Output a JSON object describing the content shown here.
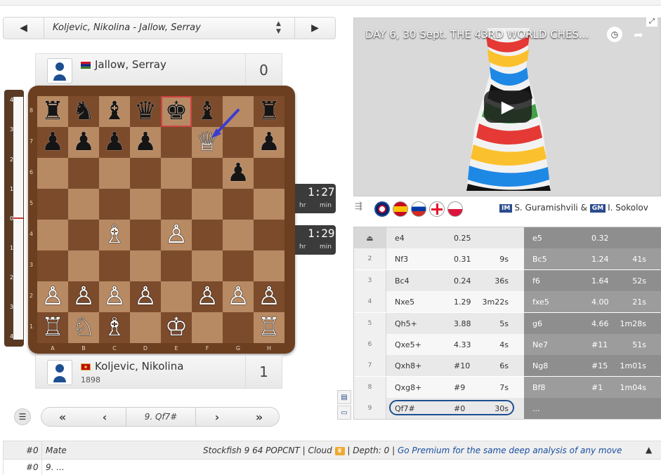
{
  "game_selector": {
    "label": "Koljevic, Nikolina - Jallow, Serray",
    "prev_icon": "triangle-left",
    "next_icon": "triangle-right"
  },
  "top_player": {
    "name": "Jallow, Serray",
    "score": "0",
    "rating": ""
  },
  "bottom_player": {
    "name": "Koljevic, Nikolina",
    "score": "1",
    "rating": "1898"
  },
  "clocks": {
    "top": "1:27",
    "bottom": "1:29",
    "unit_hr": "hr",
    "unit_min": "min"
  },
  "eval_bar": {
    "labels": [
      "4",
      "3",
      "2",
      "1",
      "0",
      "1",
      "2",
      "3",
      "4"
    ],
    "white_fraction": 0.5
  },
  "board": {
    "files": [
      "A",
      "B",
      "C",
      "D",
      "E",
      "F",
      "G",
      "H"
    ],
    "ranks": [
      "8",
      "7",
      "6",
      "5",
      "4",
      "3",
      "2",
      "1"
    ],
    "highlight": "e8",
    "arrow": {
      "from": "g8",
      "to": "f7",
      "color": "#3b3bd1"
    },
    "pieces": [
      {
        "sq": "a8",
        "p": "♜",
        "c": "b"
      },
      {
        "sq": "b8",
        "p": "♞",
        "c": "b"
      },
      {
        "sq": "c8",
        "p": "♝",
        "c": "b"
      },
      {
        "sq": "d8",
        "p": "♛",
        "c": "b"
      },
      {
        "sq": "e8",
        "p": "♚",
        "c": "b"
      },
      {
        "sq": "f8",
        "p": "♝",
        "c": "b"
      },
      {
        "sq": "h8",
        "p": "♜",
        "c": "b"
      },
      {
        "sq": "a7",
        "p": "♟",
        "c": "b"
      },
      {
        "sq": "b7",
        "p": "♟",
        "c": "b"
      },
      {
        "sq": "c7",
        "p": "♟",
        "c": "b"
      },
      {
        "sq": "d7",
        "p": "♟",
        "c": "b"
      },
      {
        "sq": "h7",
        "p": "♟",
        "c": "b"
      },
      {
        "sq": "f7",
        "p": "♕",
        "c": "w"
      },
      {
        "sq": "g6",
        "p": "♟",
        "c": "b"
      },
      {
        "sq": "c4",
        "p": "♗",
        "c": "w"
      },
      {
        "sq": "e4",
        "p": "♙",
        "c": "w"
      },
      {
        "sq": "a2",
        "p": "♙",
        "c": "w"
      },
      {
        "sq": "b2",
        "p": "♙",
        "c": "w"
      },
      {
        "sq": "c2",
        "p": "♙",
        "c": "w"
      },
      {
        "sq": "d2",
        "p": "♙",
        "c": "w"
      },
      {
        "sq": "f2",
        "p": "♙",
        "c": "w"
      },
      {
        "sq": "g2",
        "p": "♙",
        "c": "w"
      },
      {
        "sq": "h2",
        "p": "♙",
        "c": "w"
      },
      {
        "sq": "a1",
        "p": "♖",
        "c": "w"
      },
      {
        "sq": "b1",
        "p": "♘",
        "c": "w"
      },
      {
        "sq": "c1",
        "p": "♗",
        "c": "w"
      },
      {
        "sq": "e1",
        "p": "♔",
        "c": "w"
      },
      {
        "sq": "h1",
        "p": "♖",
        "c": "w"
      }
    ]
  },
  "nav": {
    "first": "«",
    "prev": "‹",
    "current": "9. Qf7#",
    "next": "›",
    "last": "»"
  },
  "video": {
    "title": "DAY 6, 30 Sept. THE 43RD WORLD CHES...",
    "clock_icon": "clock-icon",
    "share_icon": "share-icon",
    "play_icon": "play-icon"
  },
  "commentary": {
    "tag1": "IM",
    "name1": "S. Guramishvili",
    "amp": "&",
    "tag2": "GM",
    "name2": "I. Sokolov"
  },
  "moves": [
    {
      "n": "",
      "w": "e4",
      "we": "0.25",
      "wt": "",
      "b": "e5",
      "be": "0.32",
      "bt": ""
    },
    {
      "n": "2",
      "w": "Nf3",
      "we": "0.31",
      "wt": "9s",
      "b": "Bc5",
      "be": "1.24",
      "bt": "41s"
    },
    {
      "n": "3",
      "w": "Bc4",
      "we": "0.24",
      "wt": "36s",
      "b": "f6",
      "be": "1.64",
      "bt": "52s"
    },
    {
      "n": "4",
      "w": "Nxe5",
      "we": "1.29",
      "wt": "3m22s",
      "b": "fxe5",
      "be": "4.00",
      "bt": "21s"
    },
    {
      "n": "5",
      "w": "Qh5+",
      "we": "3.88",
      "wt": "5s",
      "b": "g6",
      "be": "4.66",
      "bt": "1m28s"
    },
    {
      "n": "6",
      "w": "Qxe5+",
      "we": "4.33",
      "wt": "4s",
      "b": "Ne7",
      "be": "#11",
      "bt": "51s"
    },
    {
      "n": "7",
      "w": "Qxh8+",
      "we": "#10",
      "wt": "6s",
      "b": "Ng8",
      "be": "#15",
      "bt": "1m01s"
    },
    {
      "n": "8",
      "w": "Qxg8+",
      "we": "#9",
      "wt": "7s",
      "b": "Bf8",
      "be": "#1",
      "bt": "1m04s"
    },
    {
      "n": "9",
      "w": "Qf7#",
      "we": "#0",
      "wt": "30s",
      "b": "...",
      "be": "",
      "bt": ""
    }
  ],
  "engine": {
    "line1_score": "#0",
    "line1_label": "Mate",
    "engine_name": "Stockfish 9 64 POPCNT",
    "cloud": "Cloud",
    "depth": "Depth: 0",
    "premium": "Go Premium for the same deep analysis of any move",
    "line2_score": "#0",
    "line2_moves": "9. ..."
  },
  "colors": {
    "accent": "#1d4f91",
    "board_light": "#b88a63",
    "board_dark": "#7c4b2c",
    "frame": "#6b3f20"
  }
}
